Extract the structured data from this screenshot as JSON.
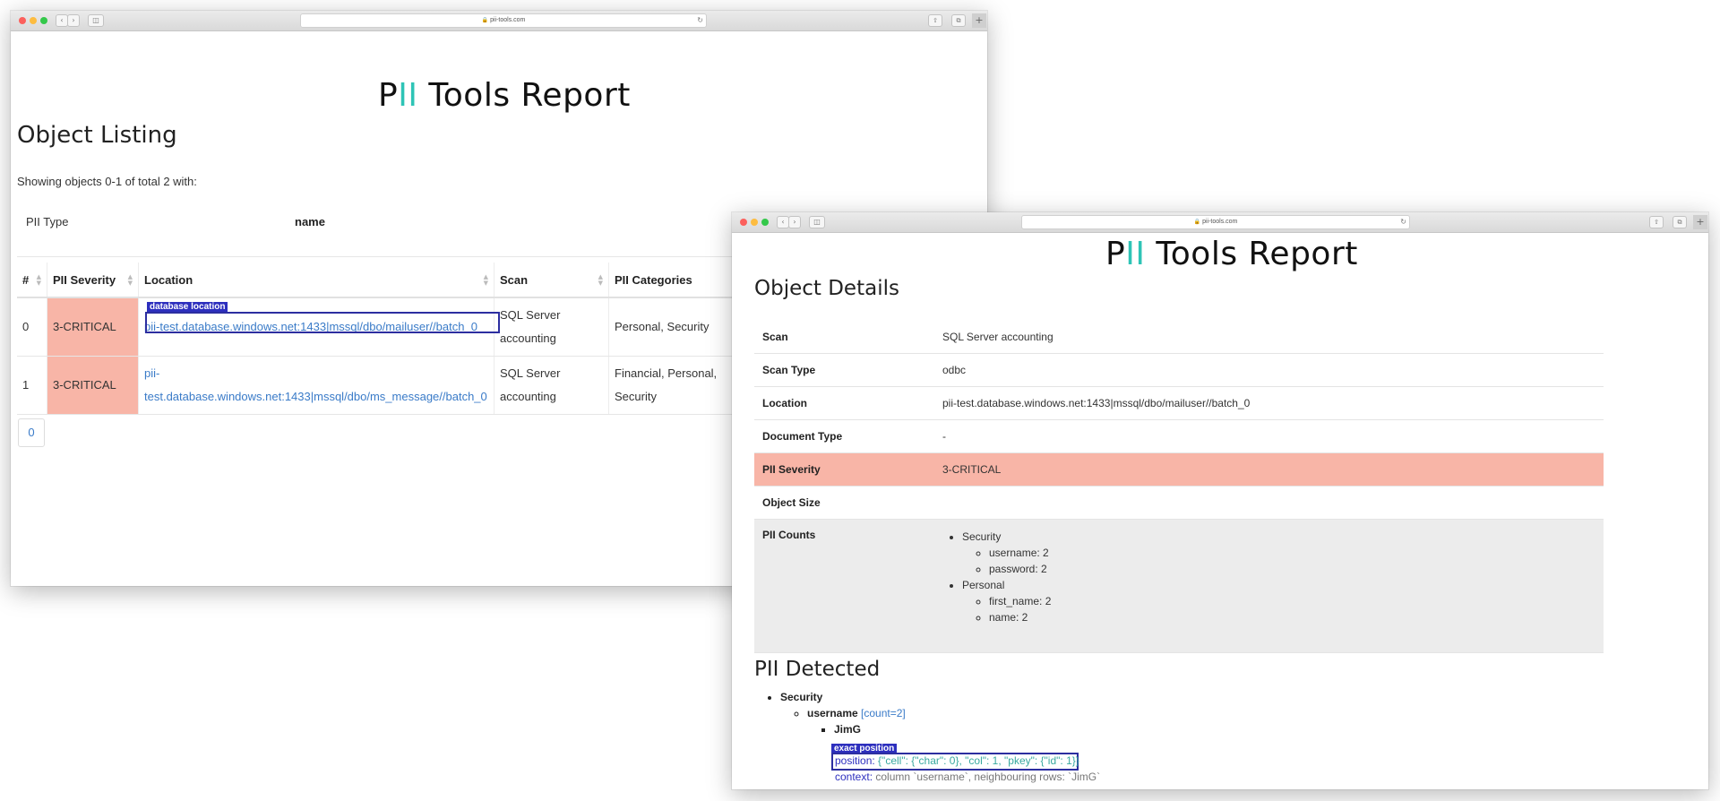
{
  "browser": {
    "url": "pii-tools.com",
    "icons": {
      "lock": "lock-icon",
      "reload": "reload-icon",
      "back": "chevron-left-icon",
      "forward": "chevron-right-icon",
      "sidebar": "sidebar-icon",
      "share": "share-icon",
      "tabs": "tabs-icon",
      "new_tab": "plus-icon"
    }
  },
  "logo": {
    "p": "P",
    "ii": "II",
    "rest": " Tools Report"
  },
  "listing": {
    "title": "Object Listing",
    "showing": "Showing objects 0-1 of total 2 with:",
    "filter": {
      "label": "PII Type",
      "value": "name"
    },
    "columns": [
      "#",
      "PII Severity",
      "Location",
      "Scan",
      "PII Categories"
    ],
    "rows": [
      {
        "num": "0",
        "severity": "3-CRITICAL",
        "location": "pii-test.database.windows.net:1433|mssql/dbo/mailuser//batch_0",
        "scan": "SQL Server accounting",
        "categories": "Personal, Security"
      },
      {
        "num": "1",
        "severity": "3-CRITICAL",
        "location_line1": "pii-",
        "location_line2": "test.database.windows.net:1433|mssql/dbo/ms_message//batch_0",
        "scan": "SQL Server accounting",
        "categories": "Financial, Personal, Security"
      }
    ],
    "pager": "0",
    "annotation": "database location"
  },
  "details": {
    "title": "Object Details",
    "fields": [
      {
        "key": "Scan",
        "value": "SQL Server accounting"
      },
      {
        "key": "Scan Type",
        "value": "odbc"
      },
      {
        "key": "Location",
        "value": "pii-test.database.windows.net:1433|mssql/dbo/mailuser//batch_0"
      },
      {
        "key": "Document Type",
        "value": "-"
      },
      {
        "key": "PII Severity",
        "value": "3-CRITICAL"
      },
      {
        "key": "Object Size",
        "value": ""
      }
    ],
    "counts": {
      "key": "PII Counts",
      "groups": [
        {
          "name": "Security",
          "items": [
            "username: 2",
            "password: 2"
          ]
        },
        {
          "name": "Personal",
          "items": [
            "first_name: 2",
            "name: 2"
          ]
        }
      ]
    },
    "severity_color": "#f8b5a7"
  },
  "detected": {
    "title": "PII Detected",
    "category": "Security",
    "type": "username",
    "count": "[count=2]",
    "value": "JimG",
    "position_label": "position",
    "position_value": "{\"cell\": {\"char\": 0}, \"col\": 1, \"pkey\": {\"id\": 1}}",
    "context_label": "context",
    "context_value": "column `username`, neighbouring rows: `JimG`",
    "annotation": "exact position"
  },
  "colors": {
    "accent_teal": "#2ec4b6",
    "link_blue": "#3a7bc8",
    "annotation_blue": "#2d2fbe",
    "critical_bg": "#f8b5a7"
  }
}
